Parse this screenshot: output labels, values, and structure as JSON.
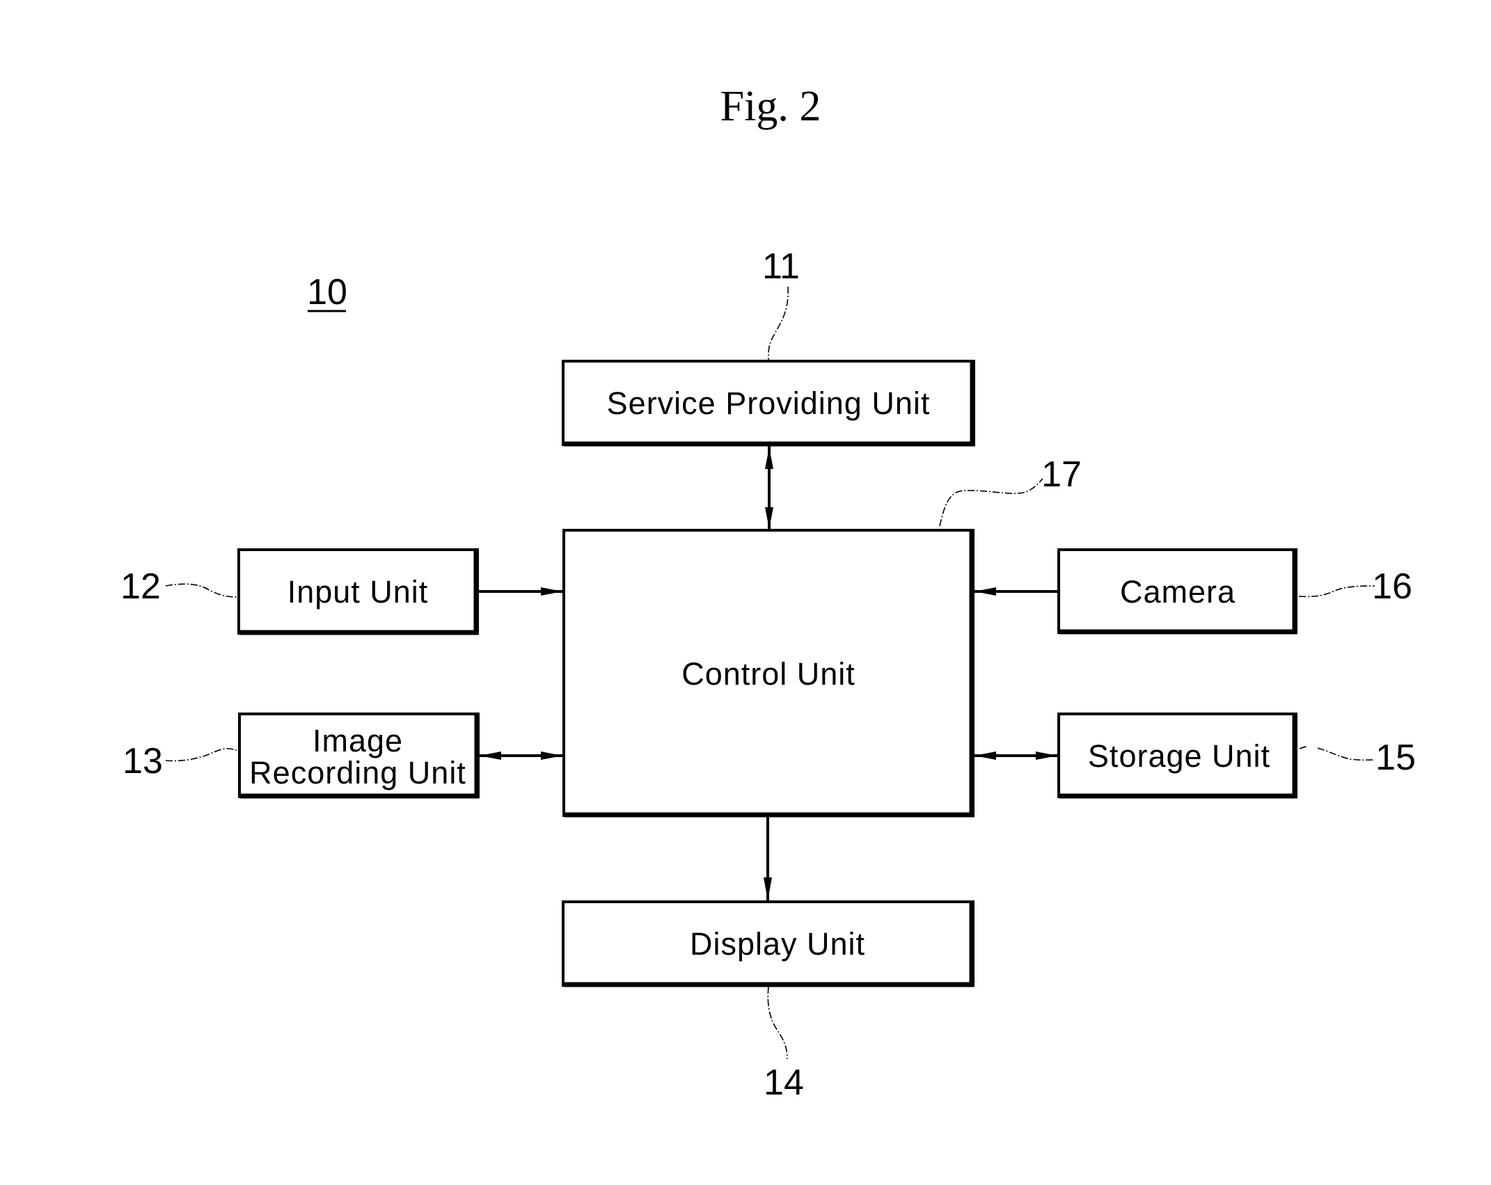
{
  "figure": {
    "title": "Fig. 2",
    "system_ref": "10"
  },
  "blocks": {
    "service": {
      "label": "Service Providing Unit",
      "ref": "11"
    },
    "input": {
      "label": "Input Unit",
      "ref": "12"
    },
    "image_recording": {
      "label_line1": "Image",
      "label_line2": "Recording Unit",
      "ref": "13"
    },
    "display": {
      "label": "Display Unit",
      "ref": "14"
    },
    "storage": {
      "label": "Storage Unit",
      "ref": "15"
    },
    "camera": {
      "label": "Camera",
      "ref": "16"
    },
    "control": {
      "label": "Control Unit",
      "ref": "17"
    }
  },
  "connections": [
    {
      "from": "service",
      "to": "control",
      "direction": "bidirectional"
    },
    {
      "from": "input",
      "to": "control",
      "direction": "to-control"
    },
    {
      "from": "image_recording",
      "to": "control",
      "direction": "bidirectional"
    },
    {
      "from": "camera",
      "to": "control",
      "direction": "to-control"
    },
    {
      "from": "storage",
      "to": "control",
      "direction": "bidirectional"
    },
    {
      "from": "control",
      "to": "display",
      "direction": "to-display"
    }
  ]
}
